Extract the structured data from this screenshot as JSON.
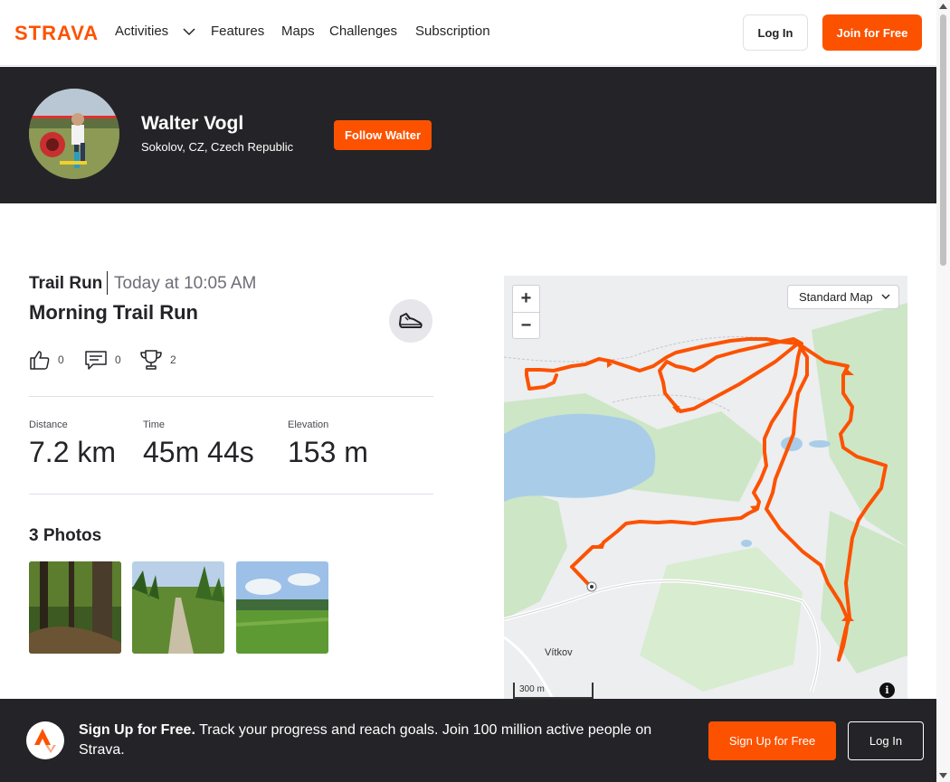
{
  "nav": {
    "brand": "STRAVA",
    "items": [
      "Activities",
      "Features",
      "Maps",
      "Challenges",
      "Subscription"
    ],
    "login": "Log In",
    "join": "Join for Free"
  },
  "athlete": {
    "name": "Walter Vogl",
    "location": "Sokolov, CZ, Czech Republic",
    "follow": "Follow Walter"
  },
  "activity": {
    "type": "Trail Run",
    "date": "Today at 10:05 AM",
    "title": "Morning Trail Run",
    "kudos": "0",
    "comments": "0",
    "achievements": "2",
    "stats": [
      {
        "label": "Distance",
        "value": "7.2 km"
      },
      {
        "label": "Time",
        "value": "45m 44s"
      },
      {
        "label": "Elevation",
        "value": "153 m"
      }
    ],
    "photos_title": "3 Photos"
  },
  "map": {
    "style": "Standard Map",
    "scale": "300 m",
    "town": "Vítkov",
    "zoom_in": "+",
    "zoom_out": "−",
    "info": "i"
  },
  "banner": {
    "headline": "Sign Up for Free.",
    "text": "Track your progress and reach goals. Join 100 million active people on Strava.",
    "signup": "Sign Up for Free",
    "login": "Log In"
  },
  "colors": {
    "brand": "#fc5200",
    "dark": "#242428",
    "route": "#fc5200"
  }
}
